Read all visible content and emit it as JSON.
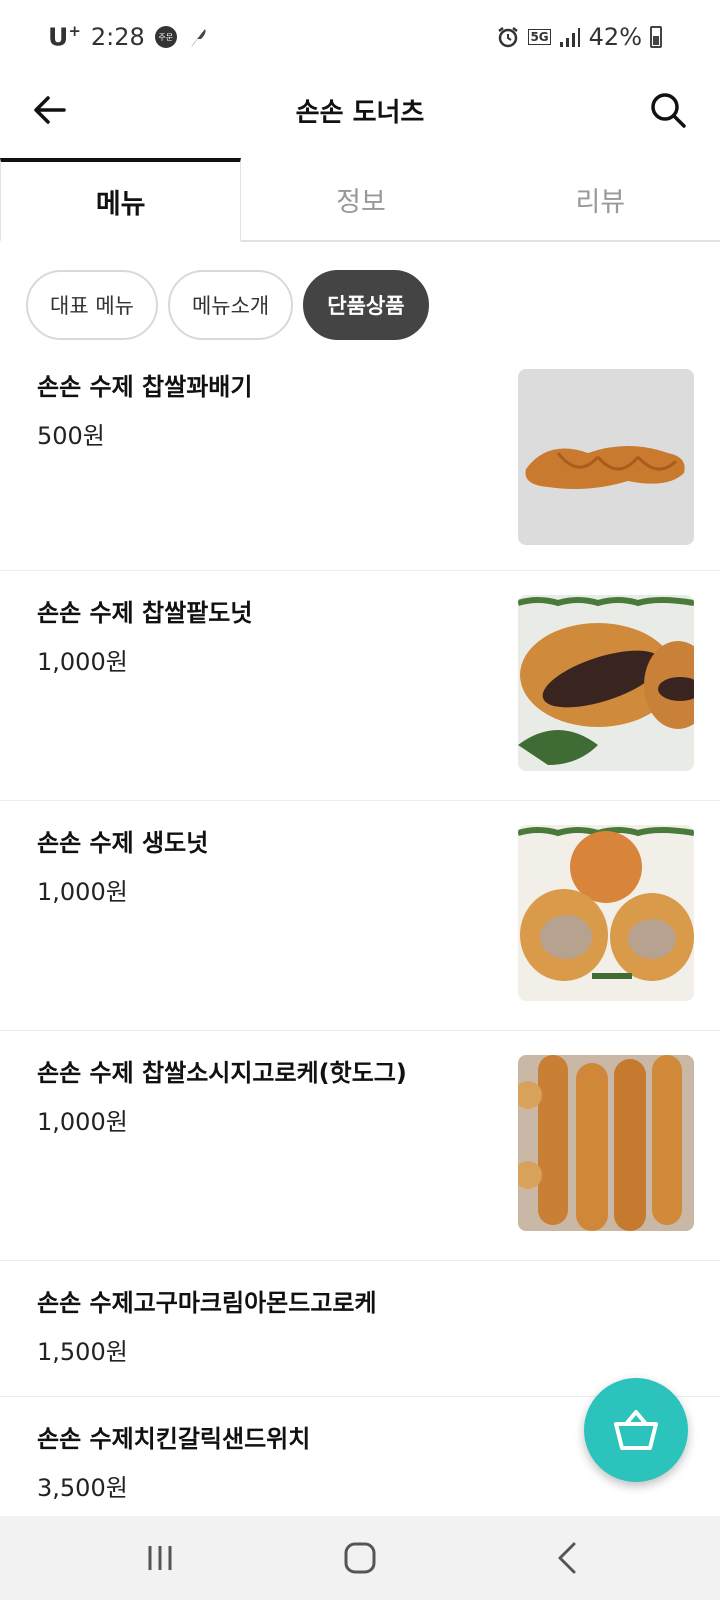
{
  "status_bar": {
    "carrier": "U",
    "carrier_plus": "+",
    "time": "2:28",
    "badge": "주문",
    "network": "5G",
    "battery": "42%"
  },
  "header": {
    "title": "손손 도너츠"
  },
  "tabs": [
    {
      "label": "메뉴",
      "active": true
    },
    {
      "label": "정보",
      "active": false
    },
    {
      "label": "리뷰",
      "active": false
    }
  ],
  "chips": [
    {
      "label": "대표 메뉴",
      "active": false
    },
    {
      "label": "메뉴소개",
      "active": false
    },
    {
      "label": "단품상품",
      "active": true
    }
  ],
  "menu_items": [
    {
      "name": "손손 수제 찹쌀꽈배기",
      "price": "500원",
      "has_image": true
    },
    {
      "name": "손손 수제 찹쌀팥도넛",
      "price": "1,000원",
      "has_image": true
    },
    {
      "name": "손손 수제 생도넛",
      "price": "1,000원",
      "has_image": true
    },
    {
      "name": "손손 수제 찹쌀소시지고로케(핫도그)",
      "price": "1,000원",
      "has_image": true
    },
    {
      "name": "손손 수제고구마크림아몬드고로케",
      "price": "1,500원",
      "has_image": false
    },
    {
      "name": "손손 수제치킨갈릭샌드위치",
      "price": "3,500원",
      "has_image": false
    }
  ],
  "colors": {
    "accent": "#2cc3bc",
    "chip_active": "#444444"
  },
  "icons": {
    "back": "arrow-left-icon",
    "search": "search-icon",
    "cart": "basket-icon"
  }
}
